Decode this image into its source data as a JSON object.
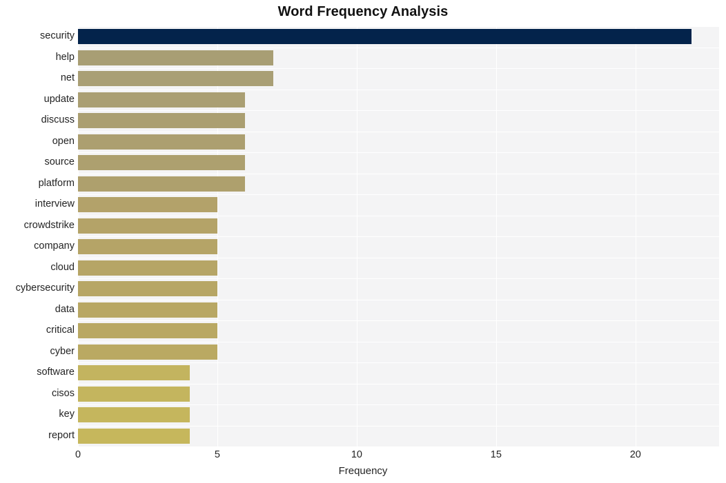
{
  "chart_data": {
    "type": "bar",
    "orientation": "horizontal",
    "title": "Word Frequency Analysis",
    "xlabel": "Frequency",
    "ylabel": "",
    "categories": [
      "security",
      "help",
      "net",
      "update",
      "discuss",
      "open",
      "source",
      "platform",
      "interview",
      "crowdstrike",
      "company",
      "cloud",
      "cybersecurity",
      "data",
      "critical",
      "cyber",
      "software",
      "cisos",
      "key",
      "report"
    ],
    "values": [
      22,
      7,
      7,
      6,
      6,
      6,
      6,
      6,
      5,
      5,
      5,
      5,
      5,
      5,
      5,
      5,
      4,
      4,
      4,
      4
    ],
    "xlim": [
      0,
      23
    ],
    "xticks": [
      "0",
      "5",
      "10",
      "15",
      "20"
    ],
    "xtick_values": [
      0,
      5,
      10,
      15,
      20
    ],
    "grid": true,
    "legend": null,
    "bar_colors": [
      "#03234b",
      "#a89e74",
      "#a99f75",
      "#aa9f73",
      "#ab9f71",
      "#ac9f70",
      "#ada06f",
      "#aea06d",
      "#b3a26a",
      "#b4a368",
      "#b5a467",
      "#b6a566",
      "#b7a665",
      "#b8a764",
      "#b9a863",
      "#baa962",
      "#c3b45f",
      "#c4b55e",
      "#c5b65d",
      "#c6b75c"
    ],
    "plot_background": "#f4f4f5",
    "gridline_color": "#ffffff",
    "page_background": "#ffffff",
    "text_color": "#242424"
  }
}
